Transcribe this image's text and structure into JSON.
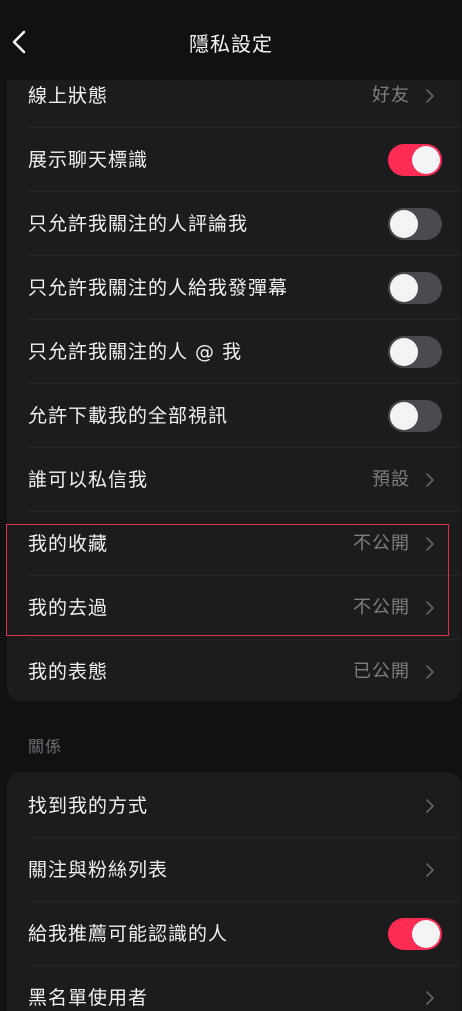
{
  "header": {
    "title": "隱私設定"
  },
  "privacy_items": [
    {
      "label": "線上狀態",
      "value": "好友"
    },
    {
      "label": "展示聊天標識",
      "toggle_state": "on"
    },
    {
      "label": "只允許我關注的人評論我",
      "toggle_state": "off"
    },
    {
      "label": "只允許我關注的人給我發彈幕",
      "toggle_state": "off"
    },
    {
      "label": "只允許我關注的人 @ 我",
      "toggle_state": "off"
    },
    {
      "label": "允許下載我的全部視訊",
      "toggle_state": "off"
    },
    {
      "label": "誰可以私信我",
      "value": "預設"
    },
    {
      "label": "我的收藏",
      "value": "不公開"
    },
    {
      "label": "我的去過",
      "value": "不公開"
    },
    {
      "label": "我的表態",
      "value": "已公開"
    }
  ],
  "relationship_section": {
    "header": "關係",
    "items": [
      {
        "label": "找到我的方式"
      },
      {
        "label": "關注與粉絲列表"
      },
      {
        "label": "給我推薦可能認識的人",
        "toggle_state": "on"
      },
      {
        "label": "黑名單使用者"
      }
    ]
  },
  "colors": {
    "accent": "#fe2c55",
    "background": "#111113",
    "card": "#1c1c1f",
    "highlight_border": "#e0303c"
  }
}
